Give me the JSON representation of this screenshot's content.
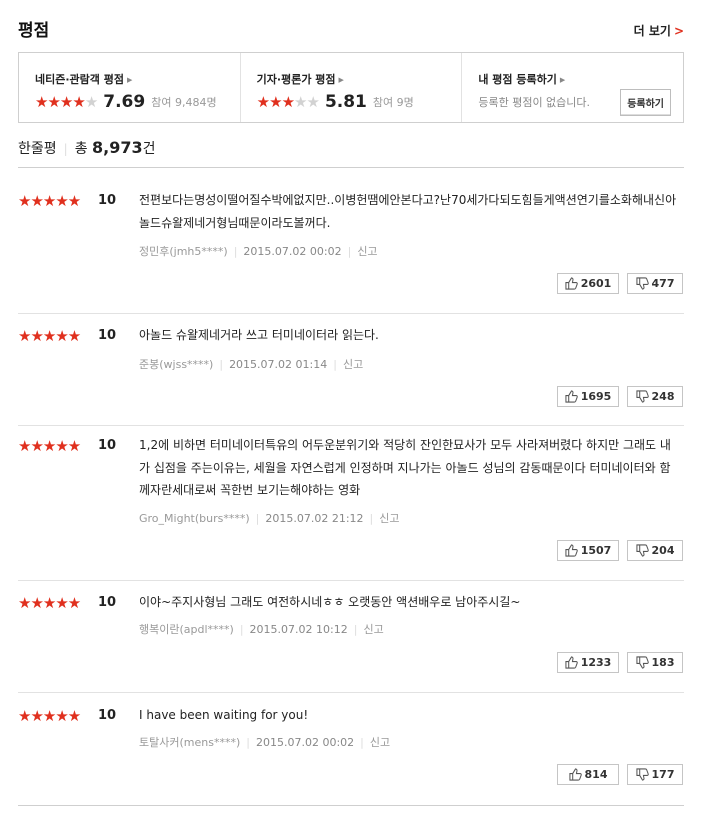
{
  "header": {
    "title": "평점",
    "more_label": "더 보기",
    "more_chevron": ">"
  },
  "score_box": {
    "netizen": {
      "label": "네티즌·관람객 평점",
      "stars": 4,
      "score": "7.69",
      "count": "참여 9,484명"
    },
    "critic": {
      "label": "기자·평론가 평점",
      "stars": 3,
      "score": "5.81",
      "count": "참여 9명"
    },
    "mine": {
      "label": "내 평점 등록하기",
      "message": "등록한 평점이 없습니다.",
      "button": "등록하기"
    },
    "star_glyph": "★",
    "accent_color": "#e0301e"
  },
  "summary": {
    "label": "한줄평",
    "separator": "|",
    "total_prefix": "총",
    "total": "8,973",
    "unit": "건"
  },
  "reviews": [
    {
      "stars": "★★★★★",
      "score": "10",
      "text": "전편보다는명성이떨어질수박에없지만..이병헌땜에안본다고?난70세가다되도힘들게액션연기를소화해내신아놀드슈왈제네거형님때문이라도볼꺼다.",
      "author": "정민후(jmh5****)",
      "date": "2015.07.02 00:02",
      "report": "신고",
      "likes": "2601",
      "dislikes": "477"
    },
    {
      "stars": "★★★★★",
      "score": "10",
      "text": "아놀드 슈왈제네거라 쓰고 터미네이터라 읽는다.",
      "author": "준봉(wjss****)",
      "date": "2015.07.02 01:14",
      "report": "신고",
      "likes": "1695",
      "dislikes": "248"
    },
    {
      "stars": "★★★★★",
      "score": "10",
      "text": "1,2에 비하면 터미네이터특유의 어두운분위기와 적당히 잔인한묘사가 모두 사라져버렸다 하지만 그래도 내가 십점을 주는이유는, 세월을 자연스럽게 인정하며 지나가는 아놀드 성님의 감동때문이다 터미네이터와 함께자란세대로써 꼭한번 보기는해야하는 영화",
      "author": "Gro_Might(burs****)",
      "date": "2015.07.02 21:12",
      "report": "신고",
      "likes": "1507",
      "dislikes": "204"
    },
    {
      "stars": "★★★★★",
      "score": "10",
      "text": "이야~주지사형님 그래도 여전하시네ㅎㅎ 오랫동안 액션배우로 남아주시길~",
      "author": "행복이란(apdl****)",
      "date": "2015.07.02 10:12",
      "report": "신고",
      "likes": "1233",
      "dislikes": "183"
    },
    {
      "stars": "★★★★★",
      "score": "10",
      "text": "I have been waiting for you!",
      "author": "토탈사커(mens****)",
      "date": "2015.07.02 00:02",
      "report": "신고",
      "likes": "814",
      "dislikes": "177"
    }
  ]
}
